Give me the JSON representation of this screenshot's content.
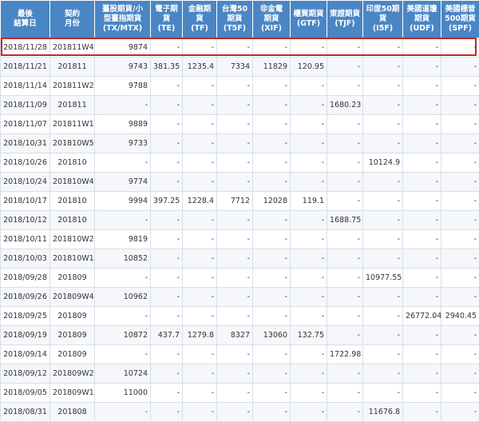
{
  "headers": [
    [
      "最後",
      "結算日"
    ],
    [
      "契約",
      "月份"
    ],
    [
      "臺股期貨/小",
      "型臺指期貨",
      "(TX/MTX)"
    ],
    [
      "電子期",
      "貨",
      "(TE)"
    ],
    [
      "金融期",
      "貨",
      "(TF)"
    ],
    [
      "台灣50",
      "期貨",
      "(T5F)"
    ],
    [
      "非金電",
      "期貨",
      "(XIF)"
    ],
    [
      "櫃買期貨",
      "(GTF)"
    ],
    [
      "東證期貨",
      "(TJF)"
    ],
    [
      "印度50期",
      "貨",
      "(I5F)"
    ],
    [
      "美國道瓊",
      "期貨",
      "(UDF)"
    ],
    [
      "美國標普",
      "500期貨",
      "(SPF)"
    ]
  ],
  "highlight_color": "#c0282e",
  "rows": [
    [
      "2018/11/28",
      "201811W4",
      "9874",
      "-",
      "-",
      "-",
      "-",
      "-",
      "-",
      "-",
      "-",
      "-"
    ],
    [
      "2018/11/21",
      "201811",
      "9743",
      "381.35",
      "1235.4",
      "7334",
      "11829",
      "120.95",
      "-",
      "-",
      "-",
      "-"
    ],
    [
      "2018/11/14",
      "201811W2",
      "9788",
      "-",
      "-",
      "-",
      "-",
      "-",
      "-",
      "-",
      "-",
      "-"
    ],
    [
      "2018/11/09",
      "201811",
      "-",
      "-",
      "-",
      "-",
      "-",
      "-",
      "1680.23",
      "-",
      "-",
      "-"
    ],
    [
      "2018/11/07",
      "201811W1",
      "9889",
      "-",
      "-",
      "-",
      "-",
      "-",
      "-",
      "-",
      "-",
      "-"
    ],
    [
      "2018/10/31",
      "201810W5",
      "9733",
      "-",
      "-",
      "-",
      "-",
      "-",
      "-",
      "-",
      "-",
      "-"
    ],
    [
      "2018/10/26",
      "201810",
      "-",
      "-",
      "-",
      "-",
      "-",
      "-",
      "-",
      "10124.9",
      "-",
      "-"
    ],
    [
      "2018/10/24",
      "201810W4",
      "9774",
      "-",
      "-",
      "-",
      "-",
      "-",
      "-",
      "-",
      "-",
      "-"
    ],
    [
      "2018/10/17",
      "201810",
      "9994",
      "397.25",
      "1228.4",
      "7712",
      "12028",
      "119.1",
      "-",
      "-",
      "-",
      "-"
    ],
    [
      "2018/10/12",
      "201810",
      "-",
      "-",
      "-",
      "-",
      "-",
      "-",
      "1688.75",
      "-",
      "-",
      "-"
    ],
    [
      "2018/10/11",
      "201810W2",
      "9819",
      "-",
      "-",
      "-",
      "-",
      "-",
      "-",
      "-",
      "-",
      "-"
    ],
    [
      "2018/10/03",
      "201810W1",
      "10852",
      "-",
      "-",
      "-",
      "-",
      "-",
      "-",
      "-",
      "-",
      "-"
    ],
    [
      "2018/09/28",
      "201809",
      "-",
      "-",
      "-",
      "-",
      "-",
      "-",
      "-",
      "10977.55",
      "-",
      "-"
    ],
    [
      "2018/09/26",
      "201809W4",
      "10962",
      "-",
      "-",
      "-",
      "-",
      "-",
      "-",
      "-",
      "-",
      "-"
    ],
    [
      "2018/09/25",
      "201809",
      "-",
      "-",
      "-",
      "-",
      "-",
      "-",
      "-",
      "-",
      "26772.04",
      "2940.45"
    ],
    [
      "2018/09/19",
      "201809",
      "10872",
      "437.7",
      "1279.8",
      "8327",
      "13060",
      "132.75",
      "-",
      "-",
      "-",
      "-"
    ],
    [
      "2018/09/14",
      "201809",
      "-",
      "-",
      "-",
      "-",
      "-",
      "-",
      "1722.98",
      "-",
      "-",
      "-"
    ],
    [
      "2018/09/12",
      "201809W2",
      "10724",
      "-",
      "-",
      "-",
      "-",
      "-",
      "-",
      "-",
      "-",
      "-"
    ],
    [
      "2018/09/05",
      "201809W1",
      "11000",
      "-",
      "-",
      "-",
      "-",
      "-",
      "-",
      "-",
      "-",
      "-"
    ],
    [
      "2018/08/31",
      "201808",
      "-",
      "-",
      "-",
      "-",
      "-",
      "-",
      "-",
      "11676.8",
      "-",
      "-"
    ]
  ]
}
